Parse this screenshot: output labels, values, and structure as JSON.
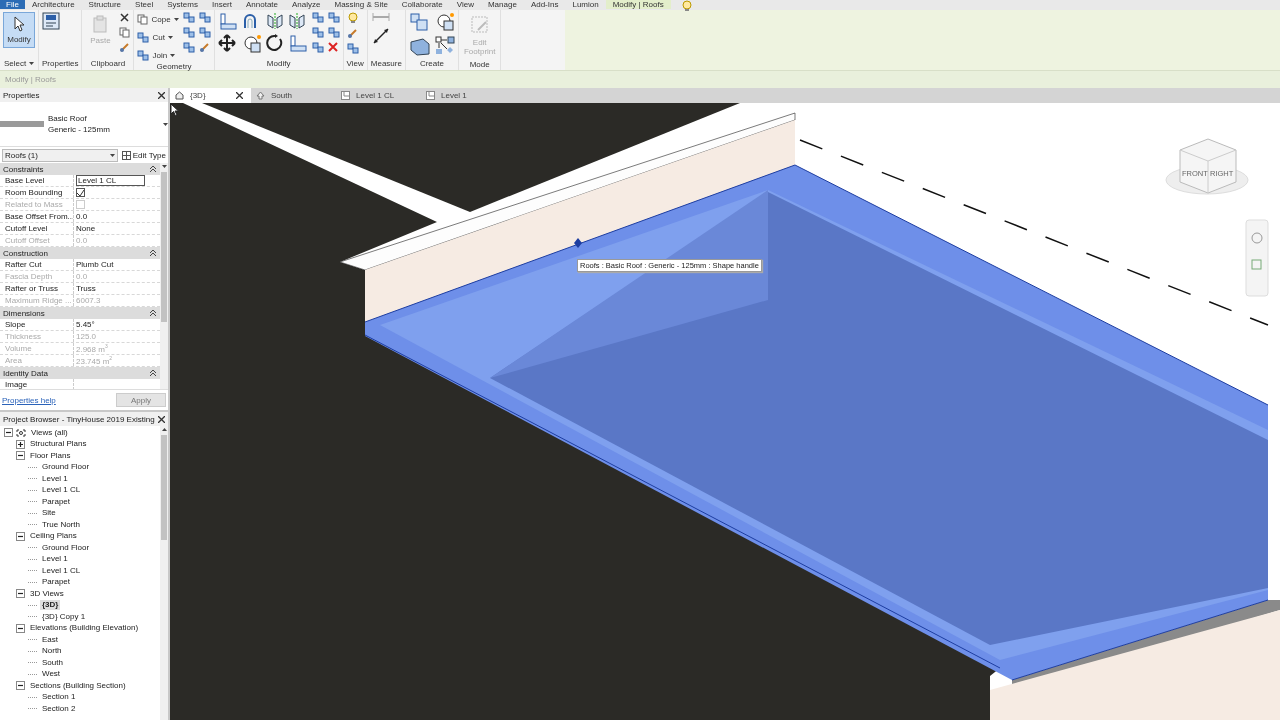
{
  "ribbon": {
    "tabs": [
      {
        "label": "File",
        "selected": false,
        "kind": "file"
      },
      {
        "label": "Architecture",
        "selected": false
      },
      {
        "label": "Structure",
        "selected": false
      },
      {
        "label": "Steel",
        "selected": false
      },
      {
        "label": "Systems",
        "selected": false
      },
      {
        "label": "Insert",
        "selected": false
      },
      {
        "label": "Annotate",
        "selected": false
      },
      {
        "label": "Analyze",
        "selected": false
      },
      {
        "label": "Massing & Site",
        "selected": false
      },
      {
        "label": "Collaborate",
        "selected": false
      },
      {
        "label": "View",
        "selected": false
      },
      {
        "label": "Manage",
        "selected": false
      },
      {
        "label": "Add-Ins",
        "selected": false
      },
      {
        "label": "Lumion",
        "selected": false
      },
      {
        "label": "Modify | Roofs",
        "selected": true
      }
    ],
    "panels": [
      {
        "title": "Select",
        "dropdown": true,
        "tools": [
          {
            "label": "Modify",
            "kind": "large",
            "active": true
          }
        ]
      },
      {
        "title": "Properties"
      },
      {
        "title": "Clipboard",
        "tools": [
          {
            "label": "Paste",
            "kind": "large",
            "disabled": true
          }
        ]
      },
      {
        "title": "Geometry",
        "tools": [
          {
            "label": "Cope",
            "kind": "small"
          },
          {
            "label": "Cut",
            "kind": "small"
          },
          {
            "label": "Join",
            "kind": "small"
          }
        ]
      },
      {
        "title": "Modify"
      },
      {
        "title": "View"
      },
      {
        "title": "Measure"
      },
      {
        "title": "Create"
      },
      {
        "title": "Mode",
        "tools": [
          {
            "label": "Edit Footprint",
            "kind": "large",
            "disabled": true
          }
        ]
      }
    ]
  },
  "options_bar": {
    "context": "Modify | Roofs"
  },
  "properties": {
    "title": "Properties",
    "type_name": "Basic Roof",
    "type_detail": "Generic - 125mm",
    "filter": "Roofs (1)",
    "edit_type": "Edit Type",
    "groups": [
      {
        "title": "Constraints",
        "rows": [
          {
            "label": "Base Level",
            "value": "Level 1 CL",
            "kind": "field",
            "disabled": false
          },
          {
            "label": "Room Bounding",
            "kind": "checkbox",
            "checked": true,
            "disabled": false
          },
          {
            "label": "Related to Mass",
            "kind": "checkbox",
            "checked": false,
            "disabled": true
          },
          {
            "label": "Base Offset From...",
            "value": "0.0",
            "kind": "text",
            "disabled": false
          },
          {
            "label": "Cutoff Level",
            "value": "None",
            "kind": "text",
            "disabled": false
          },
          {
            "label": "Cutoff Offset",
            "value": "0.0",
            "kind": "text",
            "disabled": true
          }
        ]
      },
      {
        "title": "Construction",
        "rows": [
          {
            "label": "Rafter Cut",
            "value": "Plumb Cut",
            "kind": "text",
            "disabled": false
          },
          {
            "label": "Fascia Depth",
            "value": "0.0",
            "kind": "text",
            "disabled": true
          },
          {
            "label": "Rafter or Truss",
            "value": "Truss",
            "kind": "text",
            "disabled": false
          },
          {
            "label": "Maximum Ridge ...",
            "value": "6007.3",
            "kind": "text",
            "disabled": true
          }
        ]
      },
      {
        "title": "Dimensions",
        "rows": [
          {
            "label": "Slope",
            "value": "5.45°",
            "kind": "text",
            "disabled": false
          },
          {
            "label": "Thickness",
            "value": "125.0",
            "kind": "text",
            "disabled": true
          },
          {
            "label": "Volume",
            "value": "2.968 m$^{3}$",
            "kind": "text",
            "disabled": true
          },
          {
            "label": "Area",
            "value": "23.745 m$^{2}$",
            "kind": "text",
            "disabled": true
          }
        ]
      },
      {
        "title": "Identity Data",
        "rows": [
          {
            "label": "Image",
            "kind": "text",
            "disabled": false
          }
        ]
      }
    ],
    "help": "Properties help",
    "apply": "Apply"
  },
  "browser": {
    "title": "Project Browser - TinyHouse 2019 Existing",
    "tree": [
      {
        "label": "Views (all)",
        "expanded": true,
        "selected": false,
        "children": [
          {
            "label": "Structural Plans",
            "expanded": false,
            "selected": false
          },
          {
            "label": "Floor Plans",
            "expanded": true,
            "selected": false,
            "children": [
              {
                "label": "Ground Floor",
                "selected": false
              },
              {
                "label": "Level 1",
                "selected": false
              },
              {
                "label": "Level 1 CL",
                "selected": false
              },
              {
                "label": "Parapet",
                "selected": false
              },
              {
                "label": "Site",
                "selected": false
              },
              {
                "label": "True North",
                "selected": false
              }
            ]
          },
          {
            "label": "Ceiling Plans",
            "expanded": true,
            "selected": false,
            "children": [
              {
                "label": "Ground Floor",
                "selected": false
              },
              {
                "label": "Level 1",
                "selected": false
              },
              {
                "label": "Level 1 CL",
                "selected": false
              },
              {
                "label": "Parapet",
                "selected": false
              }
            ]
          },
          {
            "label": "3D Views",
            "expanded": true,
            "selected": false,
            "children": [
              {
                "label": "{3D}",
                "selected": true
              },
              {
                "label": "{3D} Copy 1",
                "selected": false
              }
            ]
          },
          {
            "label": "Elevations (Building Elevation)",
            "expanded": true,
            "selected": false,
            "children": [
              {
                "label": "East",
                "selected": false
              },
              {
                "label": "North",
                "selected": false
              },
              {
                "label": "South",
                "selected": false
              },
              {
                "label": "West",
                "selected": false
              }
            ]
          },
          {
            "label": "Sections (Building Section)",
            "expanded": true,
            "selected": false,
            "children": [
              {
                "label": "Section 1",
                "selected": false
              },
              {
                "label": "Section 2",
                "selected": false
              }
            ]
          }
        ]
      }
    ]
  },
  "view_tabs": [
    {
      "label": "{3D}",
      "selected": true,
      "kind": "model"
    },
    {
      "label": "South",
      "selected": false,
      "kind": "elevation"
    },
    {
      "label": "Level 1 CL",
      "selected": false,
      "kind": "plan"
    },
    {
      "label": "Level 1",
      "selected": false,
      "kind": "plan"
    }
  ],
  "view_cube": {
    "faces": [
      "FRONT",
      "RIGHT"
    ]
  },
  "tooltip": "Roofs : Basic Roof : Generic - 125mm : Shape handle"
}
